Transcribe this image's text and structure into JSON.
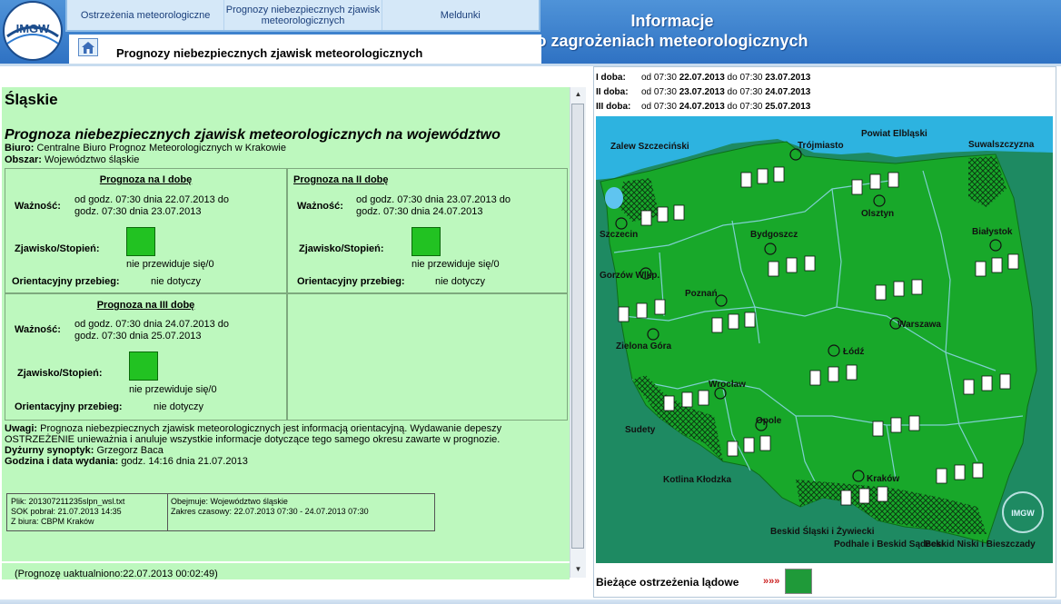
{
  "header": {
    "nav": [
      "Ostrzeżenia meteorologiczne",
      "Prognozy niebezpiecznych zjawisk meteorologicznych",
      "Meldunki"
    ],
    "title_line1": "Informacje",
    "title_line2": "o zagrożeniach meteorologicznych",
    "page_subtitle": "Prognozy niebezpiecznych zjawisk meteorologicznych",
    "logo_text": "IMGW"
  },
  "forecast": {
    "region": "Śląskie",
    "heading": "Prognoza niebezpiecznych zjawisk meteorologicznych na województwo",
    "biuro_label": "Biuro:",
    "biuro_value": "Centralne Biuro Prognoz Meteorologicznych w Krakowie",
    "obszar_label": "Obszar:",
    "obszar_value": "Województwo śląskie",
    "waznosc_label": "Ważność:",
    "zjawisko_label": "Zjawisko/Stopień:",
    "orient_label": "Orientacyjny przebieg:",
    "days": [
      {
        "title": "Prognoza na I dobę",
        "from": "od godz. 07:30 dnia 22.07.2013 do",
        "to": "godz. 07:30 dnia 23.07.2013",
        "phenomenon": "nie przewiduje się/0",
        "course": "nie dotyczy"
      },
      {
        "title": "Prognoza na II dobę",
        "from": "od godz. 07:30 dnia 23.07.2013 do",
        "to": "godz. 07:30 dnia 24.07.2013",
        "phenomenon": "nie przewiduje się/0",
        "course": "nie dotyczy"
      },
      {
        "title": "Prognoza na III dobę",
        "from": "od godz. 07:30 dnia 24.07.2013 do",
        "to": "godz. 07:30 dnia 25.07.2013",
        "phenomenon": "nie przewiduje się/0",
        "course": "nie dotyczy"
      }
    ],
    "uwagi_label": "Uwagi:",
    "uwagi_text": "Prognoza niebezpiecznych zjawisk meteorologicznych jest informacją orientacyjną. Wydawanie depeszy OSTRZEŻENIE unieważnia i anuluje wszystkie informacje dotyczące tego samego okresu zawarte w prognozie.",
    "synoptyk_label": "Dyżurny synoptyk:",
    "synoptyk_value": "Grzegorz Baca",
    "godzina_label": "Godzina i data wydania:",
    "godzina_value": "godz. 14:16 dnia 21.07.2013",
    "file_info": {
      "plik": "Plik: 201307211235slpn_wsl.txt",
      "sok": "SOK pobrał: 21.07.2013 14:35",
      "biuro": "Z biura: CBPM Kraków",
      "obejmuje": "Obejmuje: Województwo śląskie",
      "zakres": "Zakres czasowy: 22.07.2013 07:30 - 24.07.2013 07:30"
    },
    "updated": "(Prognozę uaktualniono:22.07.2013 00:02:49)"
  },
  "periods": [
    {
      "label": "I doba:",
      "a": "od 07:30 ",
      "d1": "22.07.2013",
      "b": " do 07:30 ",
      "d2": "23.07.2013"
    },
    {
      "label": "II doba:",
      "a": "od 07:30 ",
      "d1": "23.07.2013",
      "b": " do 07:30 ",
      "d2": "24.07.2013"
    },
    {
      "label": "III doba:",
      "a": "od 07:30 ",
      "d1": "24.07.2013",
      "b": " do 07:30 ",
      "d2": "25.07.2013"
    }
  ],
  "map": {
    "labels": [
      "Zalew Szczeciński",
      "Trójmiasto",
      "Powiat Elbląski",
      "Suwalszczyzna",
      "Szczecin",
      "Olsztyn",
      "Bydgoszcz",
      "Białystok",
      "Gorzów Wlkp.",
      "Poznań",
      "Warszawa",
      "Zielona Góra",
      "Łódź",
      "Wrocław",
      "Sudety",
      "Opole",
      "Kotlina Kłodzka",
      "Kraków",
      "Beskid Śląski i Żywiecki",
      "Podhale i Beskid Sądecki",
      "Beskid Niski i Bieszczady"
    ],
    "colors": {
      "land": "#18a82a",
      "sea": "#2db3e0",
      "border": "#7fd0d0"
    }
  },
  "legend": {
    "text": "Bieżące ostrzeżenia lądowe",
    "arrows": "»»»"
  }
}
